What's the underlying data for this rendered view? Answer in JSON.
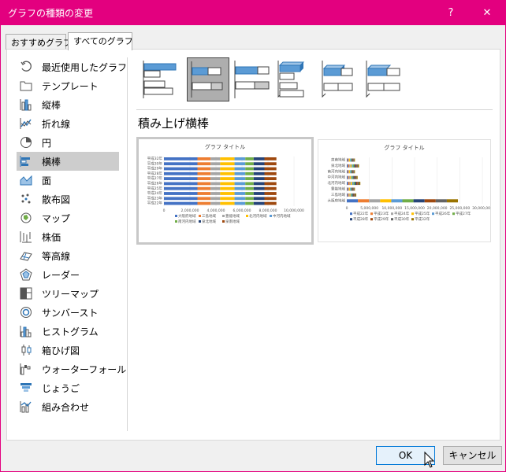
{
  "window": {
    "title": "グラフの種類の変更",
    "help_label": "?",
    "close_label": "✕"
  },
  "tabs": [
    {
      "label": "おすすめグラフ"
    },
    {
      "label": "すべてのグラフ"
    }
  ],
  "sidebar": {
    "items": [
      {
        "label": "最近使用したグラフ",
        "icon": "recent-icon"
      },
      {
        "label": "テンプレート",
        "icon": "folder-icon"
      },
      {
        "label": "縦棒",
        "icon": "column-chart-icon"
      },
      {
        "label": "折れ線",
        "icon": "line-chart-icon"
      },
      {
        "label": "円",
        "icon": "pie-chart-icon"
      },
      {
        "label": "横棒",
        "icon": "bar-chart-icon"
      },
      {
        "label": "面",
        "icon": "area-chart-icon"
      },
      {
        "label": "散布図",
        "icon": "scatter-chart-icon"
      },
      {
        "label": "マップ",
        "icon": "map-chart-icon"
      },
      {
        "label": "株価",
        "icon": "stock-chart-icon"
      },
      {
        "label": "等高線",
        "icon": "surface-chart-icon"
      },
      {
        "label": "レーダー",
        "icon": "radar-chart-icon"
      },
      {
        "label": "ツリーマップ",
        "icon": "treemap-chart-icon"
      },
      {
        "label": "サンバースト",
        "icon": "sunburst-chart-icon"
      },
      {
        "label": "ヒストグラム",
        "icon": "histogram-chart-icon"
      },
      {
        "label": "箱ひげ図",
        "icon": "box-whisker-chart-icon"
      },
      {
        "label": "ウォーターフォール",
        "icon": "waterfall-chart-icon"
      },
      {
        "label": "じょうご",
        "icon": "funnel-chart-icon"
      },
      {
        "label": "組み合わせ",
        "icon": "combo-chart-icon"
      }
    ],
    "selected": "横棒"
  },
  "subtypes": {
    "selected_title": "積み上げ横棒",
    "items": [
      "集合横棒",
      "積み上げ横棒",
      "100% 積み上げ横棒",
      "3-D 集合横棒",
      "3-D 積み上げ横棒",
      "3-D 100% 積み上げ横棒"
    ]
  },
  "preview1": {
    "title": "グラフ タイトル",
    "rows": [
      "平成32年",
      "平成30年",
      "平成29年",
      "平成28年",
      "平成27年",
      "平成26年",
      "平成25年",
      "平成24年",
      "平成23年",
      "平成22年"
    ],
    "xticks": [
      "0",
      "2,000,000",
      "4,000,000",
      "6,000,000",
      "8,000,000",
      "10,000,000"
    ],
    "legend": [
      "大阪府地域",
      "三島地域",
      "豊能地域",
      "北河内地域",
      "中河内地域",
      "南河内地域",
      "泉北地域",
      "泉南地域"
    ]
  },
  "preview2": {
    "title": "グラフ タイトル",
    "rows": [
      "泉南地域",
      "泉北地域",
      "南河内地域",
      "中河内地域",
      "北河内地域",
      "豊能地域",
      "三島地域",
      "大阪府地域"
    ],
    "xticks": [
      "0",
      "5,000,000",
      "10,000,000",
      "15,000,000",
      "20,000,000",
      "25,000,000",
      "30,000,000"
    ],
    "legend": [
      "平成22年",
      "平成23年",
      "平成24年",
      "平成25年",
      "平成26年",
      "平成27年",
      "平成28年",
      "平成29年",
      "平成30年",
      "平成32年"
    ]
  },
  "colors": {
    "accent": "#e3007f",
    "series": [
      "#4472c4",
      "#ed7d31",
      "#a5a5a5",
      "#ffc000",
      "#5b9bd5",
      "#70ad47",
      "#264478",
      "#9e480e",
      "#636363",
      "#997300"
    ]
  },
  "buttons": {
    "ok": "OK",
    "cancel": "キャンセル"
  }
}
